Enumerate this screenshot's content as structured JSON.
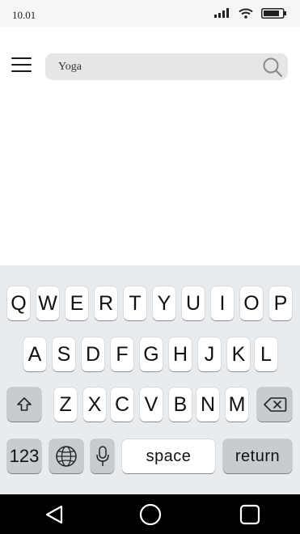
{
  "status_bar": {
    "time": "10.01",
    "icons": [
      "signal-icon",
      "wifi-icon",
      "battery-icon"
    ]
  },
  "header": {
    "menu_icon": "hamburger-menu-icon",
    "search": {
      "value": "Yoga",
      "icon": "search-icon"
    }
  },
  "keyboard": {
    "row1": [
      "Q",
      "W",
      "E",
      "R",
      "T",
      "Y",
      "U",
      "I",
      "O",
      "P"
    ],
    "row2": [
      "A",
      "S",
      "D",
      "F",
      "G",
      "H",
      "J",
      "K",
      "L"
    ],
    "row3": [
      "Z",
      "X",
      "C",
      "V",
      "B",
      "N",
      "M"
    ],
    "shift_icon": "shift-icon",
    "backspace_icon": "backspace-icon",
    "numbers_label": "123",
    "globe_icon": "globe-icon",
    "mic_icon": "microphone-icon",
    "space_label": "space",
    "return_label": "return"
  },
  "nav_bar": {
    "icons": [
      "back-triangle-icon",
      "home-circle-icon",
      "recents-square-icon"
    ]
  },
  "colors": {
    "keyboard_bg": "#e9ecef",
    "key_bg": "#ffffff",
    "function_key_bg": "#c8ccd1",
    "search_bg": "#e6e6e6",
    "nav_bar_bg": "#000000"
  }
}
